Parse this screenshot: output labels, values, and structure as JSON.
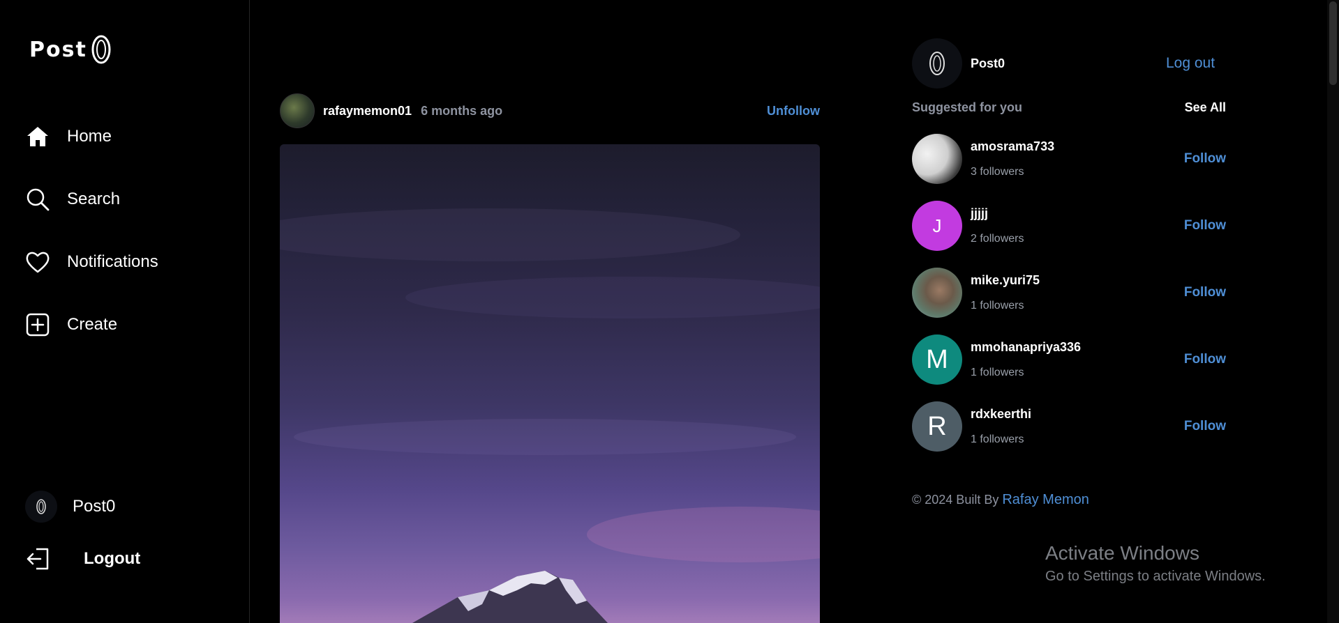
{
  "logo": {
    "text": "Post"
  },
  "nav": {
    "home": "Home",
    "search": "Search",
    "notifications": "Notifications",
    "create": "Create",
    "profile": "Post0",
    "logout": "Logout"
  },
  "post": {
    "username": "rafaymemon01",
    "time": "6 months ago",
    "action": "Unfollow"
  },
  "right": {
    "me_name": "Post0",
    "logout": "Log out",
    "suggested_title": "Suggested for you",
    "see_all": "See All",
    "suggestions": [
      {
        "name": "amosrama733",
        "followers": "3 followers",
        "action": "Follow",
        "initial": "",
        "color": "#d9d9d9"
      },
      {
        "name": "jjjjj",
        "followers": "2 followers",
        "action": "Follow",
        "initial": "J",
        "color": "#c23be0"
      },
      {
        "name": "mike.yuri75",
        "followers": "1 followers",
        "action": "Follow",
        "initial": "",
        "color": "#6d8a7a"
      },
      {
        "name": "mmohanapriya336",
        "followers": "1 followers",
        "action": "Follow",
        "initial": "M",
        "color": "#0e8a7e"
      },
      {
        "name": "rdxkeerthi",
        "followers": "1 followers",
        "action": "Follow",
        "initial": "R",
        "color": "#4e5d66"
      }
    ],
    "footer_text": "© 2024 Built By",
    "footer_credit": "Rafay Memon"
  },
  "watermark": {
    "title": "Activate Windows",
    "subtitle": "Go to Settings to activate Windows."
  }
}
